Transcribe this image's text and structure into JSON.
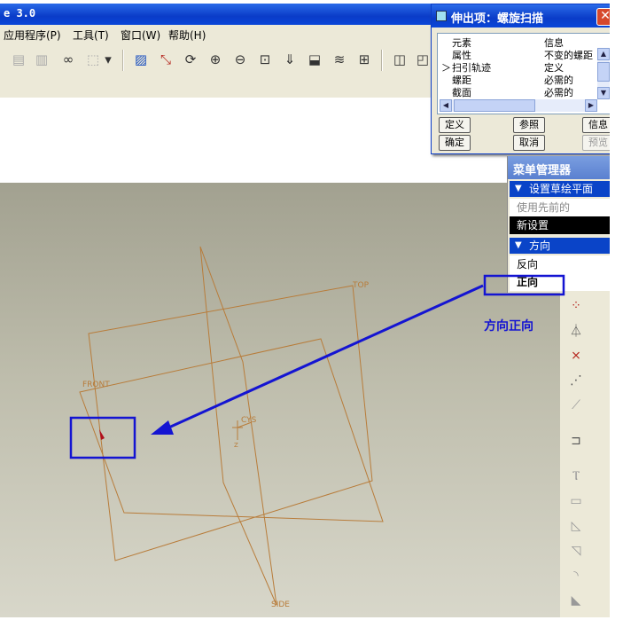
{
  "app": {
    "title": "e 3.0",
    "menu": [
      "应用程序(P)",
      "工具(T)",
      "窗口(W)",
      "帮助(H)"
    ]
  },
  "toolbar": {
    "icons": [
      "paste-icon",
      "paste-special-icon",
      "binoculars-icon",
      "select-box-icon",
      "dropdown-icon",
      "sketch-icon",
      "datum-axis-icon",
      "repaint-icon",
      "zoom-in-icon",
      "zoom-out-icon",
      "zoom-fit-icon",
      "orient-icon",
      "saved-views-icon",
      "layers-icon",
      "model-tree-icon",
      "view-3d-icon",
      "view-3d-2-icon"
    ]
  },
  "dialog": {
    "title": "伸出项：螺旋扫描",
    "close": "✕",
    "col_element": "元素",
    "col_info": "信息",
    "rows": [
      {
        "element": "属性",
        "info": "不变的螺距",
        "selected": false
      },
      {
        "element": "扫引轨迹",
        "info": "定义",
        "selected": true
      },
      {
        "element": "螺距",
        "info": "必需的",
        "selected": false
      },
      {
        "element": "截面",
        "info": "必需的",
        "selected": false
      }
    ],
    "selected_marker": "＞",
    "buttons": {
      "define": "定义",
      "refs": "参照",
      "info": "信息",
      "ok": "确定",
      "cancel": "取消",
      "preview": "预览"
    }
  },
  "menu_manager": {
    "title": "菜单管理器",
    "section_plane": "设置草绘平面",
    "use_previous": "使用先前的",
    "new_setting": "新设置",
    "section_direction": "方向",
    "flip": "反向",
    "okay": "正向"
  },
  "canvas": {
    "label_top": "TOP",
    "label_front": "FRONT",
    "label_side": "SIDE",
    "label_csys": "CYS",
    "label_z": "Z"
  },
  "annotation": {
    "text": "方向正向"
  },
  "colors": {
    "datum": "#b87c3a",
    "annotation": "#1414d2",
    "selected": "#0a44c8"
  }
}
